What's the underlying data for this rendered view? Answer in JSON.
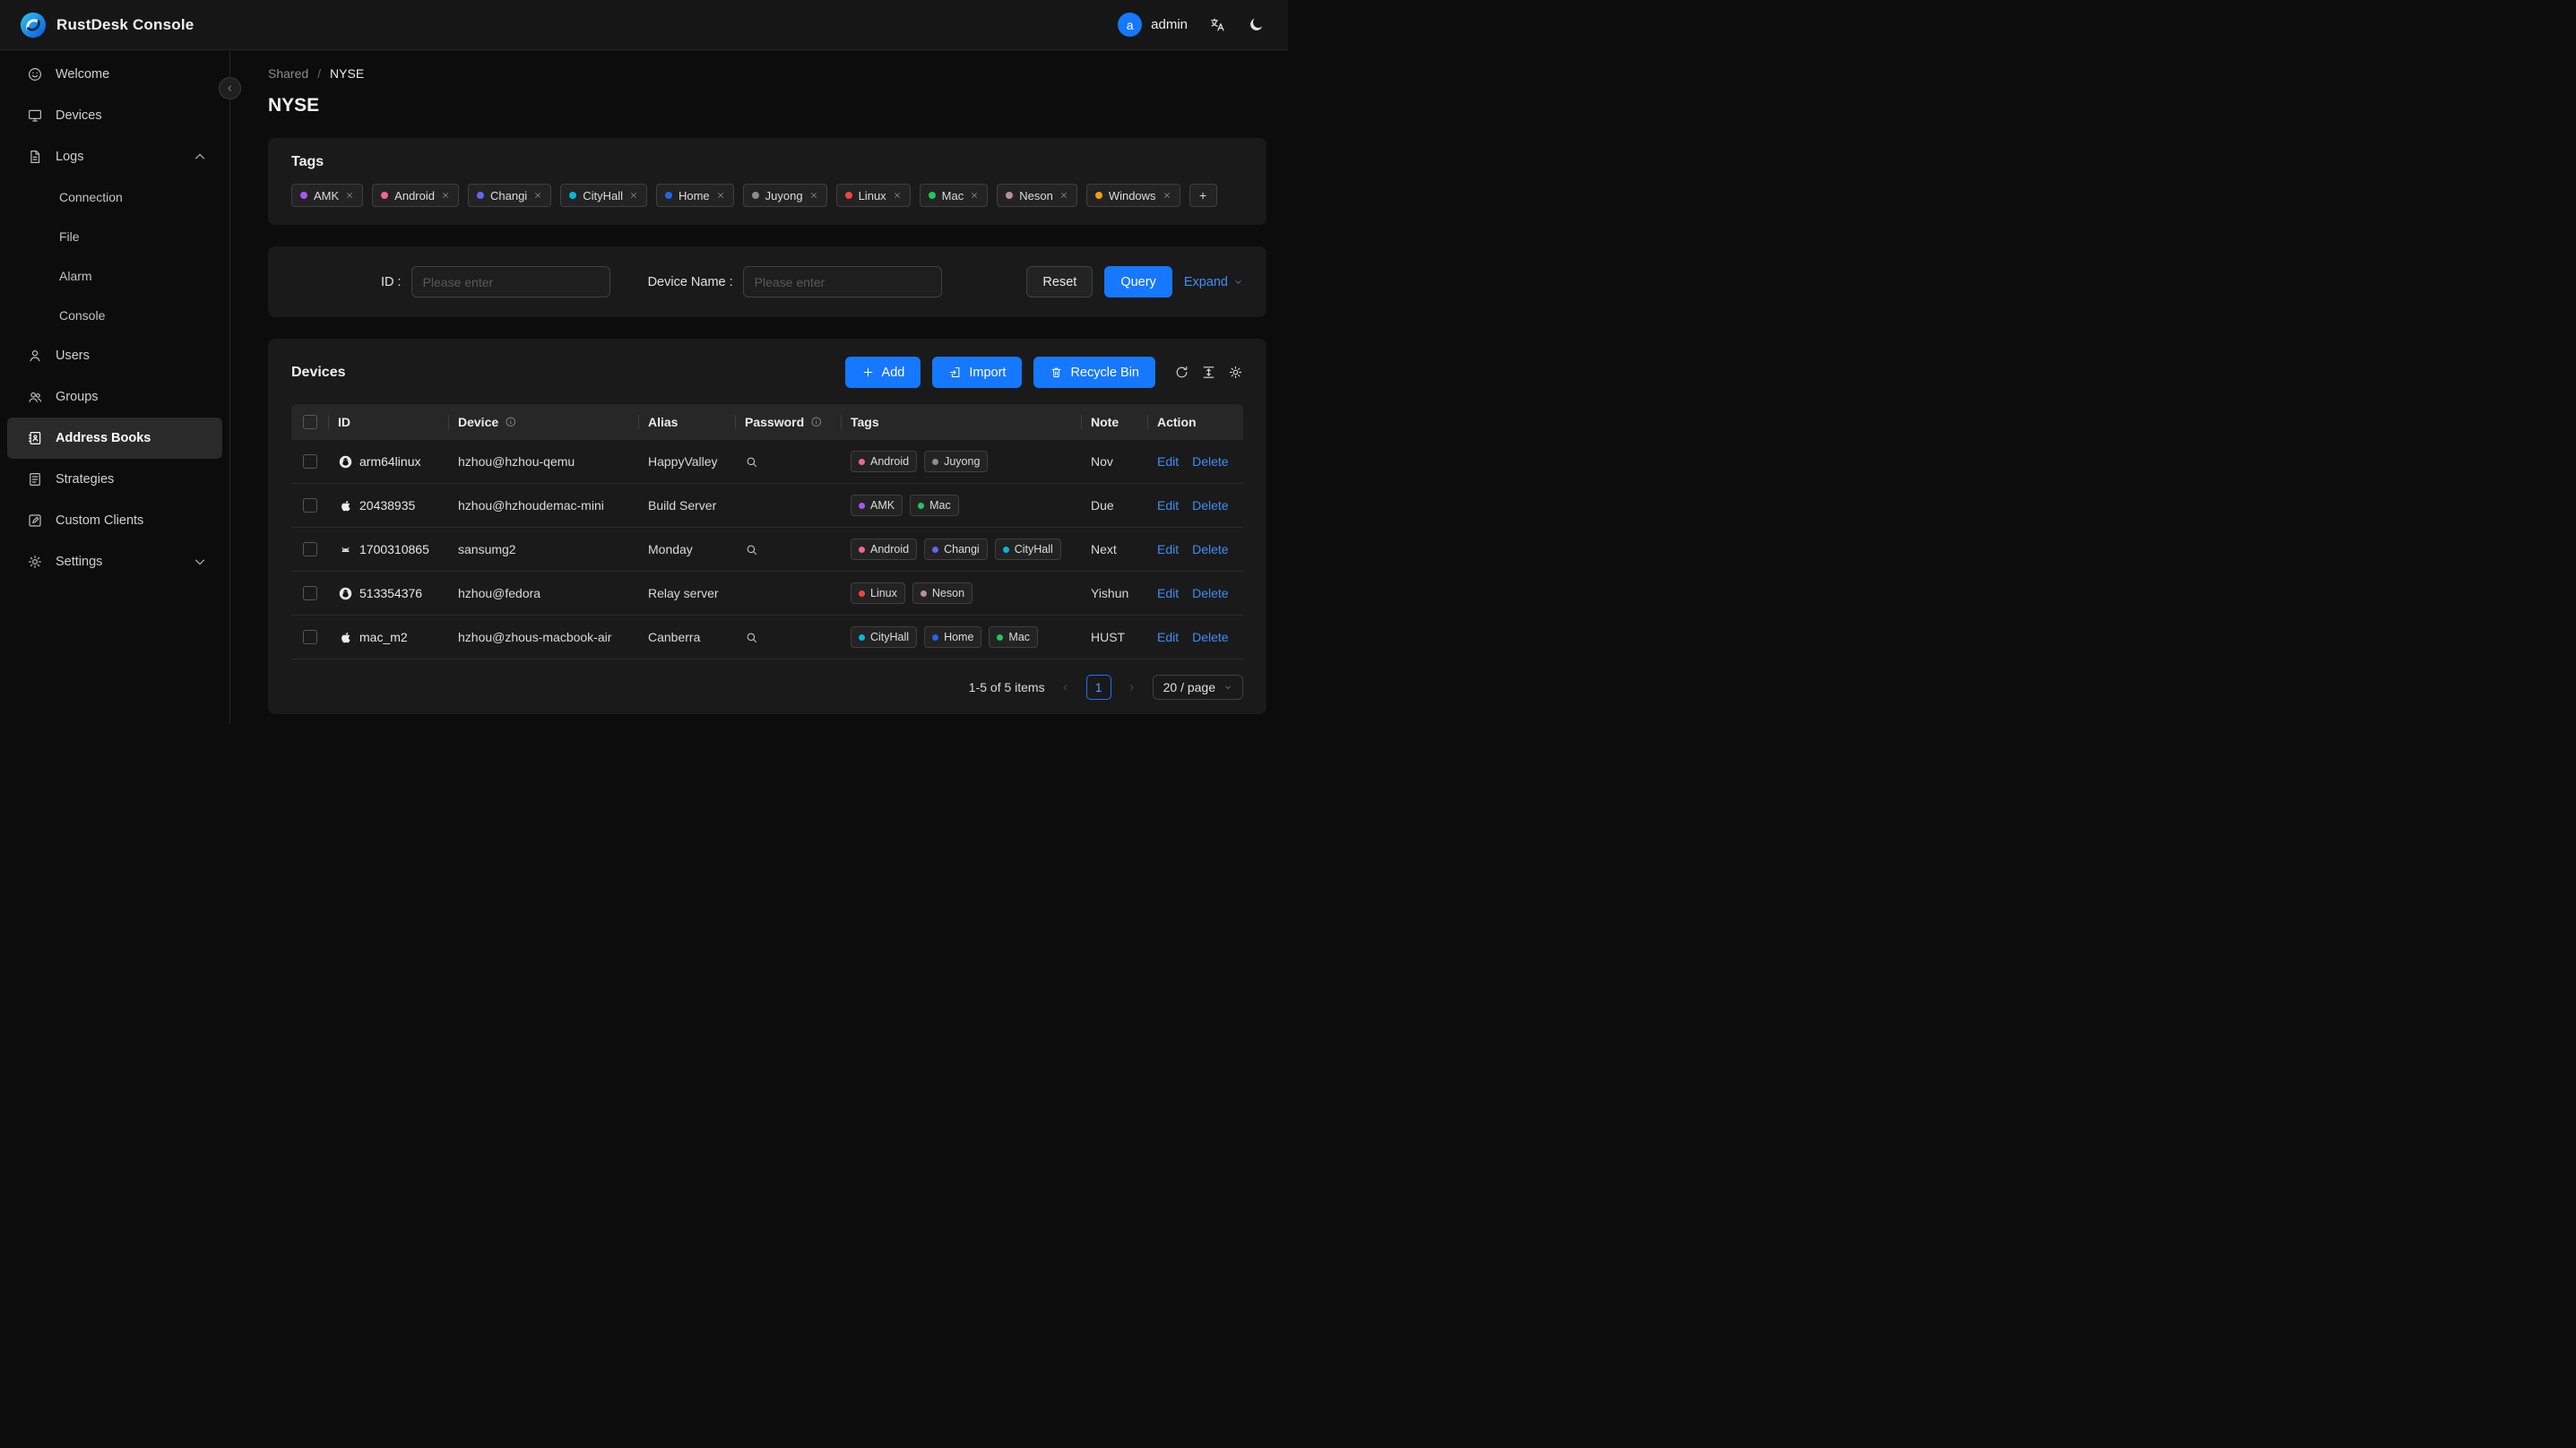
{
  "app": {
    "title": "RustDesk Console"
  },
  "header": {
    "user_initial": "a",
    "user_name": "admin"
  },
  "sidebar": {
    "items": [
      {
        "label": "Welcome",
        "icon": "smile"
      },
      {
        "label": "Devices",
        "icon": "monitor"
      },
      {
        "label": "Logs",
        "icon": "file",
        "chevron": "up",
        "children": [
          {
            "label": "Connection"
          },
          {
            "label": "File"
          },
          {
            "label": "Alarm"
          },
          {
            "label": "Console"
          }
        ]
      },
      {
        "label": "Users",
        "icon": "user"
      },
      {
        "label": "Groups",
        "icon": "group"
      },
      {
        "label": "Address Books",
        "icon": "address-book",
        "active": true
      },
      {
        "label": "Strategies",
        "icon": "strategy"
      },
      {
        "label": "Custom Clients",
        "icon": "custom-clients"
      },
      {
        "label": "Settings",
        "icon": "gear",
        "chevron": "down"
      }
    ]
  },
  "breadcrumb": {
    "parent": "Shared",
    "separator": "/",
    "current": "NYSE"
  },
  "page": {
    "title": "NYSE"
  },
  "tags_card": {
    "title": "Tags",
    "add_button": "+",
    "tags": [
      {
        "label": "AMK",
        "color": "#a855f7"
      },
      {
        "label": "Android",
        "color": "#f06595"
      },
      {
        "label": "Changi",
        "color": "#6366f1"
      },
      {
        "label": "CityHall",
        "color": "#06b6d4"
      },
      {
        "label": "Home",
        "color": "#2563eb"
      },
      {
        "label": "Juyong",
        "color": "#8c8c8c"
      },
      {
        "label": "Linux",
        "color": "#ef4444"
      },
      {
        "label": "Mac",
        "color": "#22c55e"
      },
      {
        "label": "Neson",
        "color": "#bc8f8f"
      },
      {
        "label": "Windows",
        "color": "#f59e0b"
      }
    ]
  },
  "filter": {
    "id_label": "ID :",
    "id_placeholder": "Please enter",
    "device_label": "Device Name :",
    "device_placeholder": "Please enter",
    "reset_label": "Reset",
    "query_label": "Query",
    "expand_label": "Expand"
  },
  "devices_card": {
    "title": "Devices",
    "add_label": "Add",
    "import_label": "Import",
    "recycle_label": "Recycle Bin",
    "columns": [
      {
        "label": "ID"
      },
      {
        "label": "Device",
        "info": true
      },
      {
        "label": "Alias"
      },
      {
        "label": "Password",
        "info": true
      },
      {
        "label": "Tags"
      },
      {
        "label": "Note"
      },
      {
        "label": "Action"
      }
    ],
    "action_edit": "Edit",
    "action_delete": "Delete",
    "rows": [
      {
        "os": "linux",
        "id": "arm64linux",
        "device": "hzhou@hzhou-qemu",
        "alias": "HappyValley",
        "password_lookup": true,
        "tags": [
          "Android",
          "Juyong"
        ],
        "note": "Nov"
      },
      {
        "os": "apple",
        "id": "20438935",
        "device": "hzhou@hzhoudemac-mini",
        "alias": "Build Server",
        "password_lookup": false,
        "tags": [
          "AMK",
          "Mac"
        ],
        "note": "Due"
      },
      {
        "os": "android",
        "id": "1700310865",
        "device": "sansumg2",
        "alias": "Monday",
        "password_lookup": true,
        "tags": [
          "Android",
          "Changi",
          "CityHall"
        ],
        "note": "Next"
      },
      {
        "os": "linux",
        "id": "513354376",
        "device": "hzhou@fedora",
        "alias": "Relay server",
        "password_lookup": false,
        "tags": [
          "Linux",
          "Neson"
        ],
        "note": "Yishun"
      },
      {
        "os": "apple",
        "id": "mac_m2",
        "device": "hzhou@zhous-macbook-air",
        "alias": "Canberra",
        "password_lookup": true,
        "tags": [
          "CityHall",
          "Home",
          "Mac"
        ],
        "note": "HUST"
      }
    ],
    "pagination": {
      "summary": "1-5 of 5 items",
      "current_page": "1",
      "page_size": "20 / page"
    }
  },
  "colors": {
    "primary": "#1677ff",
    "link": "#3e8ef7"
  }
}
